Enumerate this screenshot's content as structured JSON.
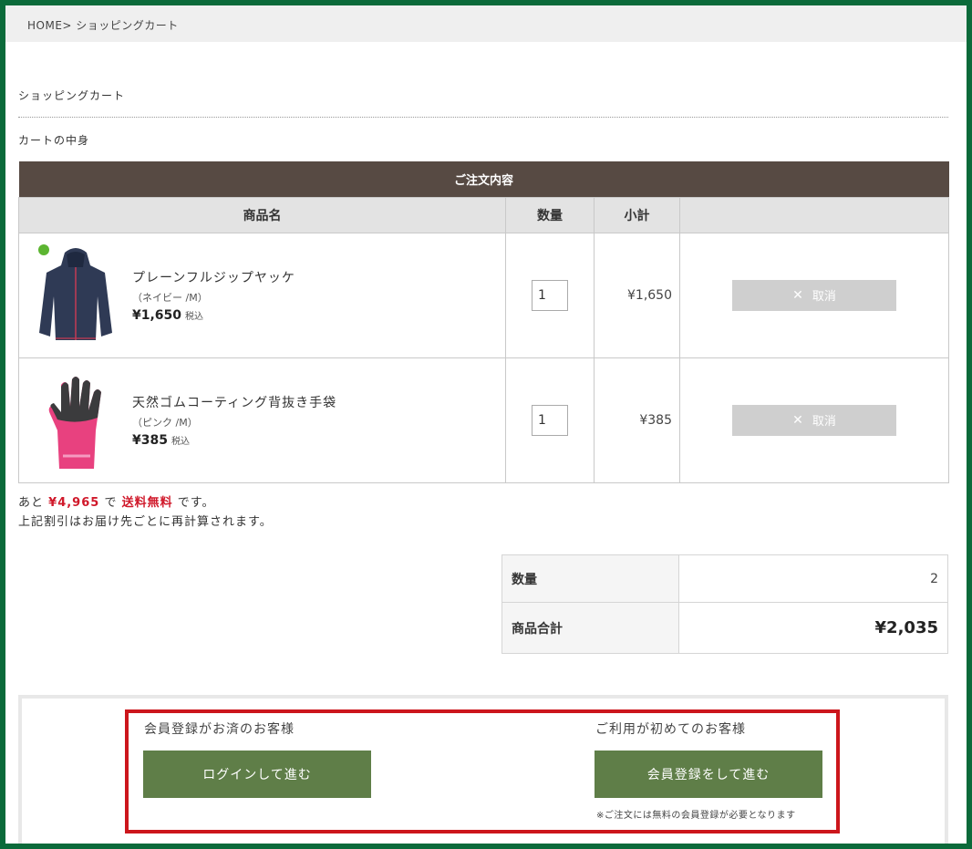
{
  "breadcrumb": {
    "home": "HOME",
    "separator": ">",
    "current": "ショッピングカート"
  },
  "page": {
    "title": "ショッピングカート",
    "section": "カートの中身"
  },
  "cart_table": {
    "caption": "ご注文内容",
    "headers": {
      "product": "商品名",
      "quantity": "数量",
      "subtotal": "小計"
    },
    "items": [
      {
        "name": "プレーンフルジップヤッケ",
        "variant": "（ネイビー /M）",
        "price": "¥1,650",
        "tax_label": "税込",
        "quantity": "1",
        "subtotal": "¥1,650",
        "cancel_label": "取消",
        "image": "navy-jacket-image",
        "color": "#2f3a55"
      },
      {
        "name": "天然ゴムコーティング背抜き手袋",
        "variant": "（ピンク /M）",
        "price": "¥385",
        "tax_label": "税込",
        "quantity": "1",
        "subtotal": "¥385",
        "cancel_label": "取消",
        "image": "pink-glove-image",
        "color": "#e8417f"
      }
    ]
  },
  "notice": {
    "prefix": "あと",
    "amount": "¥4,965",
    "middle": "で",
    "free_shipping": "送料無料",
    "suffix": "です。",
    "line2": "上記割引はお届け先ごとに再計算されます。"
  },
  "totals": {
    "quantity_label": "数量",
    "quantity_value": "2",
    "total_label": "商品合計",
    "total_value": "¥2,035"
  },
  "proceed": {
    "member_label": "会員登録がお済のお客様",
    "login_button": "ログインして進む",
    "new_label": "ご利用が初めてのお客様",
    "register_button": "会員登録をして進む",
    "register_note": "※ご注文には無料の会員登録が必要となります"
  },
  "colors": {
    "frame": "#0b6a3a",
    "table_caption_bg": "#574a43",
    "button_green": "#5f7e48",
    "highlight_red": "#cc161c",
    "price_red": "#d0182a"
  }
}
